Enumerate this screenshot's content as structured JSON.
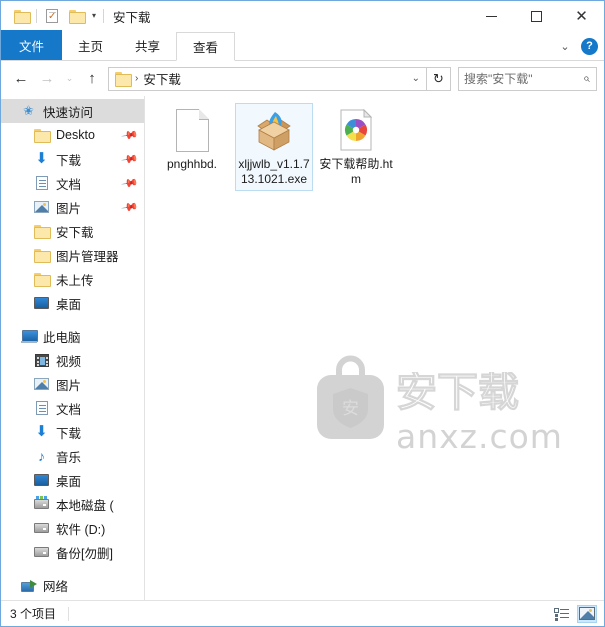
{
  "window": {
    "title": "安下载",
    "quick_access_toolbar": [
      {
        "name": "folder-icon",
        "label": ""
      },
      {
        "name": "properties-icon",
        "label": ""
      },
      {
        "name": "new-folder-icon",
        "label": ""
      },
      {
        "name": "customize-caret",
        "label": "▾"
      }
    ],
    "controls": {
      "minimize": "–",
      "maximize": "□",
      "close": "✕"
    }
  },
  "ribbon": {
    "tabs": [
      {
        "label": "文件",
        "active": false,
        "style": "file"
      },
      {
        "label": "主页",
        "active": false,
        "style": "normal"
      },
      {
        "label": "共享",
        "active": false,
        "style": "normal"
      },
      {
        "label": "查看",
        "active": true,
        "style": "normal"
      }
    ],
    "collapse_caret": "⌄",
    "help_label": "?"
  },
  "addressbar": {
    "back": "←",
    "forward": "→",
    "recent": "⌄",
    "up": "↑",
    "crumb_separator": "›",
    "crumb": "安下载",
    "dropdown_caret": "⌄",
    "refresh": "↻",
    "search_placeholder": "搜索\"安下载\"",
    "search_value": "",
    "search_icon": "⌕"
  },
  "sidebar": {
    "groups": [
      {
        "root": {
          "label": "快速访问",
          "icon": "pin-star-icon",
          "selected": true
        },
        "items": [
          {
            "label": "Deskto",
            "icon": "folder-icon",
            "pinned": true
          },
          {
            "label": "下载",
            "icon": "downloads-icon",
            "pinned": true
          },
          {
            "label": "文档",
            "icon": "documents-icon",
            "pinned": true
          },
          {
            "label": "图片",
            "icon": "pictures-icon",
            "pinned": true
          },
          {
            "label": "安下载",
            "icon": "folder-icon",
            "pinned": false
          },
          {
            "label": "图片管理器",
            "icon": "folder-icon",
            "pinned": false
          },
          {
            "label": "未上传",
            "icon": "folder-icon",
            "pinned": false
          },
          {
            "label": "桌面",
            "icon": "desktop-icon",
            "pinned": false
          }
        ]
      },
      {
        "root": {
          "label": "此电脑",
          "icon": "this-pc-icon",
          "selected": false
        },
        "items": [
          {
            "label": "视频",
            "icon": "videos-icon",
            "pinned": false
          },
          {
            "label": "图片",
            "icon": "pictures-icon",
            "pinned": false
          },
          {
            "label": "文档",
            "icon": "documents-icon",
            "pinned": false
          },
          {
            "label": "下载",
            "icon": "downloads-icon",
            "pinned": false
          },
          {
            "label": "音乐",
            "icon": "music-icon",
            "pinned": false
          },
          {
            "label": "桌面",
            "icon": "desktop-icon",
            "pinned": false
          },
          {
            "label": "本地磁盘 (",
            "icon": "system-drive-icon",
            "pinned": false
          },
          {
            "label": "软件 (D:)",
            "icon": "drive-icon",
            "pinned": false
          },
          {
            "label": "备份[勿删]",
            "icon": "drive-icon",
            "pinned": false
          }
        ]
      },
      {
        "root": {
          "label": "网络",
          "icon": "network-icon",
          "selected": false
        },
        "items": []
      }
    ]
  },
  "files": [
    {
      "name": "pnghhbd.",
      "icon": "blank-document-icon",
      "selected": false
    },
    {
      "name": "xljjwlb_v1.1.713.1021.exe",
      "icon": "installer-box-icon",
      "selected": true
    },
    {
      "name": "安下载帮助.htm",
      "icon": "html-document-icon",
      "selected": false
    }
  ],
  "watermark": {
    "logo_char": "安",
    "brand": "安下载",
    "domain": "anxz.com",
    "color": "#d3d3d3"
  },
  "statusbar": {
    "item_count_text": "3 个项目",
    "views": [
      {
        "name": "details-view-button",
        "active": false
      },
      {
        "name": "large-icons-view-button",
        "active": true
      }
    ]
  },
  "colors": {
    "accent": "#1578c8",
    "selection": "#cce8ff",
    "folder": "#fce8ab",
    "window_border": "#6fa8dc"
  }
}
